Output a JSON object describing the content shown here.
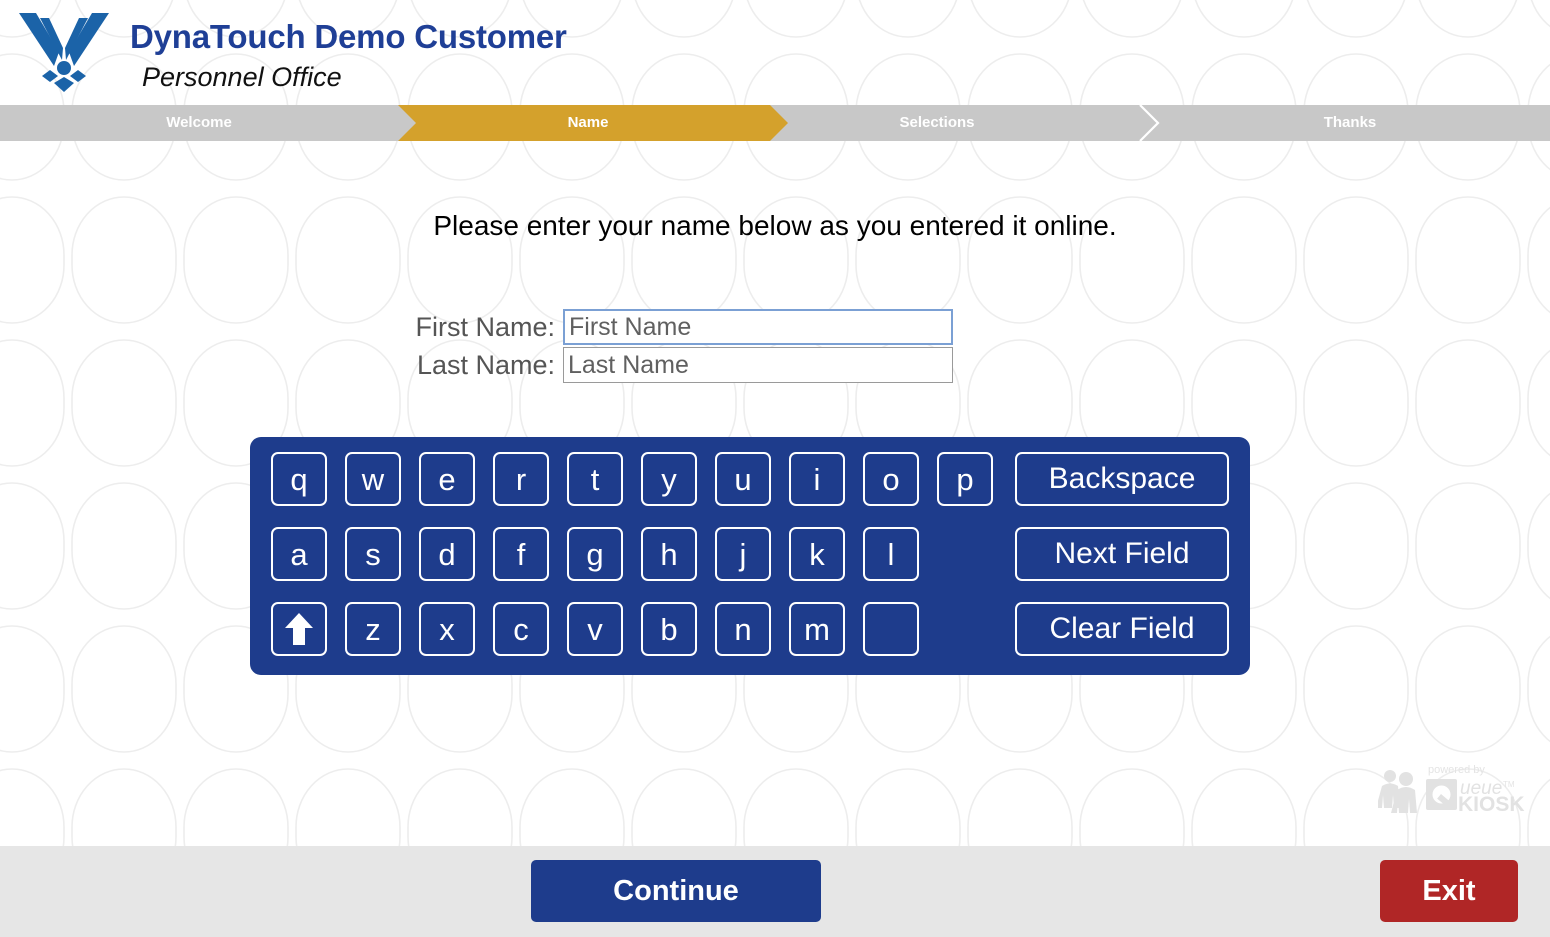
{
  "header": {
    "org_title": "DynaTouch Demo Customer",
    "org_subtitle": "Personnel Office",
    "logo_name": "air-force-wings-logo",
    "title_color": "#1f3f96"
  },
  "stepbar": {
    "active_index": 1,
    "active_color": "#d4a12c",
    "inactive_color": "#c8c8c8",
    "steps": [
      {
        "label": "Welcome",
        "state": "completed"
      },
      {
        "label": "Name",
        "state": "active"
      },
      {
        "label": "Selections",
        "state": "upcoming"
      },
      {
        "label": "Thanks",
        "state": "upcoming"
      }
    ]
  },
  "main": {
    "instruction": "Please enter your name below as you entered it online.",
    "form": {
      "fields": [
        {
          "label": "First Name:",
          "value": "First Name",
          "placeholder": "First Name",
          "focused": true
        },
        {
          "label": "Last Name:",
          "value": "Last Name",
          "placeholder": "Last Name",
          "focused": false
        }
      ]
    },
    "keyboard": {
      "background": "#1e3c8c",
      "rows": [
        {
          "keys": [
            {
              "label": "q",
              "type": "letter"
            },
            {
              "label": "w",
              "type": "letter"
            },
            {
              "label": "e",
              "type": "letter"
            },
            {
              "label": "r",
              "type": "letter"
            },
            {
              "label": "t",
              "type": "letter"
            },
            {
              "label": "y",
              "type": "letter"
            },
            {
              "label": "u",
              "type": "letter"
            },
            {
              "label": "i",
              "type": "letter"
            },
            {
              "label": "o",
              "type": "letter"
            },
            {
              "label": "p",
              "type": "letter"
            },
            {
              "label": "Backspace",
              "type": "action"
            }
          ]
        },
        {
          "keys": [
            {
              "label": "a",
              "type": "letter"
            },
            {
              "label": "s",
              "type": "letter"
            },
            {
              "label": "d",
              "type": "letter"
            },
            {
              "label": "f",
              "type": "letter"
            },
            {
              "label": "g",
              "type": "letter"
            },
            {
              "label": "h",
              "type": "letter"
            },
            {
              "label": "j",
              "type": "letter"
            },
            {
              "label": "k",
              "type": "letter"
            },
            {
              "label": "l",
              "type": "letter"
            },
            {
              "label": "Next Field",
              "type": "action"
            }
          ]
        },
        {
          "keys": [
            {
              "label": "",
              "type": "shift",
              "icon": "up-arrow-icon"
            },
            {
              "label": "z",
              "type": "letter"
            },
            {
              "label": "x",
              "type": "letter"
            },
            {
              "label": "c",
              "type": "letter"
            },
            {
              "label": "v",
              "type": "letter"
            },
            {
              "label": "b",
              "type": "letter"
            },
            {
              "label": "n",
              "type": "letter"
            },
            {
              "label": "m",
              "type": "letter"
            },
            {
              "label": "",
              "type": "space"
            },
            {
              "label": "Clear Field",
              "type": "action"
            }
          ]
        }
      ]
    },
    "brand_watermark": {
      "powered_by": "powered by",
      "name_q": "Q",
      "name_ueue": "ueue",
      "trademark": "TM",
      "name_kiosk": "KIOSK"
    }
  },
  "footer": {
    "continue_label": "Continue",
    "continue_color": "#1e3c8c",
    "exit_label": "Exit",
    "exit_color": "#b02626",
    "background": "#e6e6e6"
  }
}
